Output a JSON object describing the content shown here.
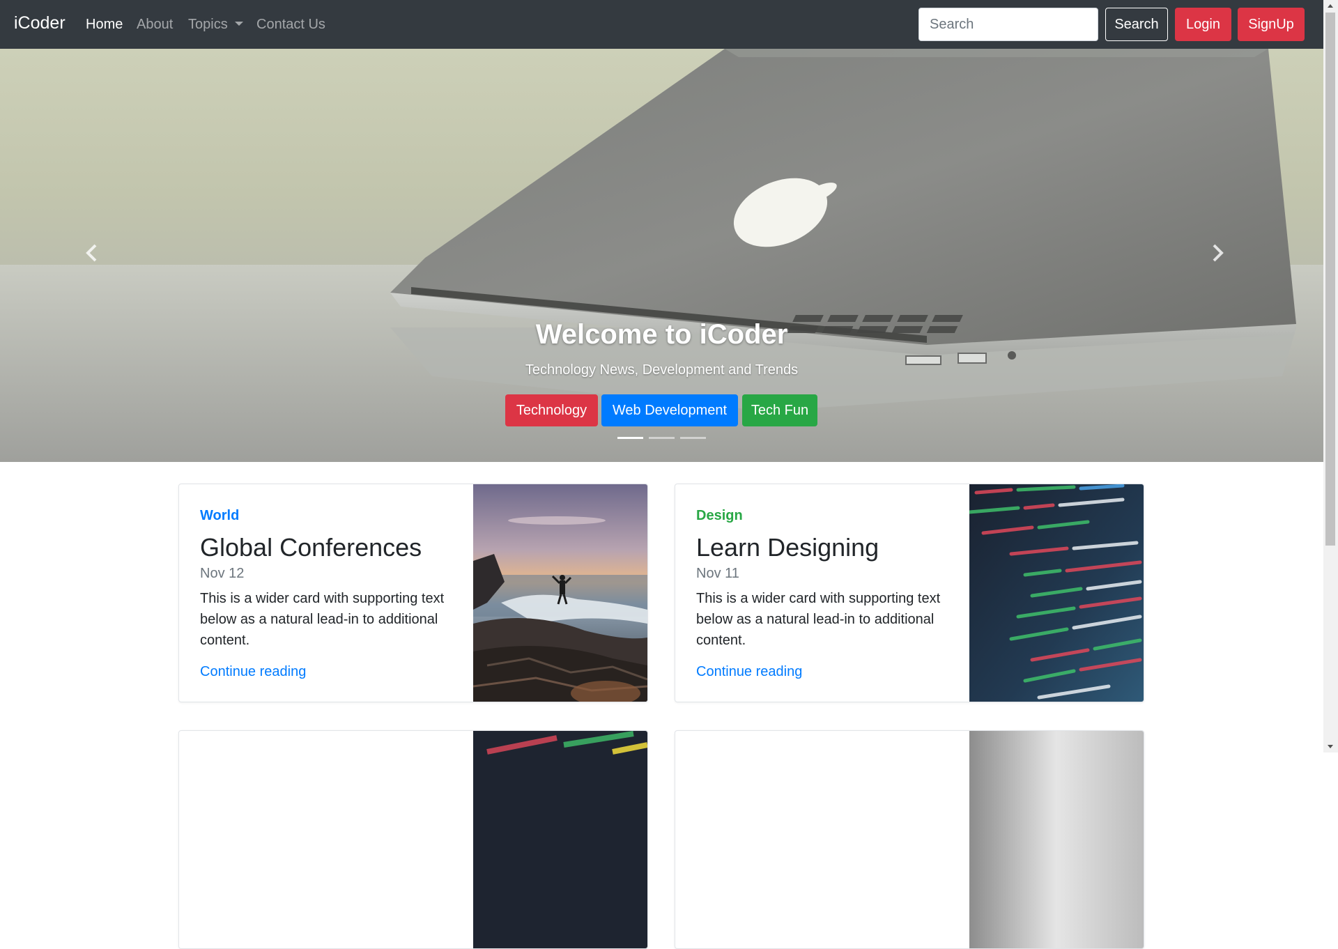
{
  "navbar": {
    "brand": "iCoder",
    "links": [
      {
        "label": "Home",
        "active": true
      },
      {
        "label": "About",
        "active": false
      },
      {
        "label": "Topics",
        "active": false,
        "dropdown": true
      },
      {
        "label": "Contact Us",
        "active": false
      }
    ],
    "search_placeholder": "Search",
    "search_button": "Search",
    "login_button": "Login",
    "signup_button": "SignUp"
  },
  "carousel": {
    "title": "Welcome to iCoder",
    "subtitle": "Technology News, Development and Trends",
    "buttons": [
      {
        "label": "Technology",
        "color": "#dc3545"
      },
      {
        "label": "Web Development",
        "color": "#007bff"
      },
      {
        "label": "Tech Fun",
        "color": "#28a745"
      }
    ],
    "slide_count": 3,
    "active_slide": 1,
    "prev_icon": "chevron-left-icon",
    "next_icon": "chevron-right-icon"
  },
  "cards": [
    {
      "category": "World",
      "category_color": "#007bff",
      "title": "Global Conferences",
      "date": "Nov 12",
      "text": "This is a wider card with supporting text below as a natural lead-in to additional content.",
      "link": "Continue reading",
      "image": "sunset-seashore-photo"
    },
    {
      "category": "Design",
      "category_color": "#28a745",
      "title": "Learn Designing",
      "date": "Nov 11",
      "text": "This is a wider card with supporting text below as a natural lead-in to additional content.",
      "link": "Continue reading",
      "image": "code-screen-photo"
    }
  ],
  "colors": {
    "navbar_bg": "#343a40",
    "danger": "#dc3545",
    "primary": "#007bff",
    "success": "#28a745"
  }
}
